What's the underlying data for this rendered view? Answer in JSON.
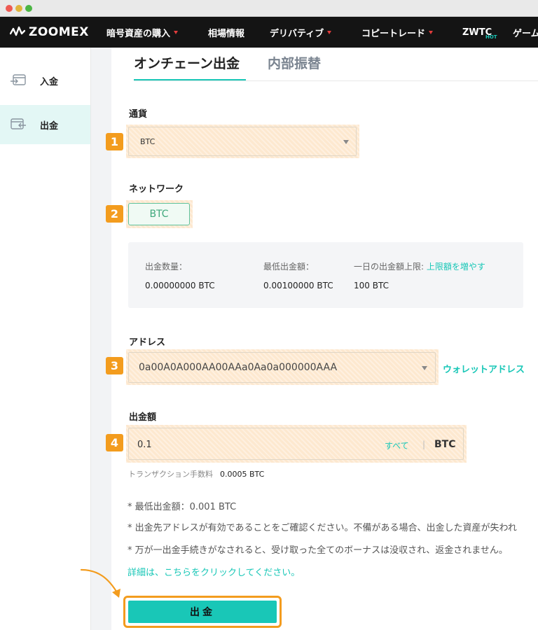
{
  "brand": {
    "name": "ZOOMEX",
    "accent_color": "#19c7b7",
    "highlight_color": "#f39c1e",
    "nav_bg": "#141414"
  },
  "nav": {
    "items": [
      {
        "label": "暗号資産の購入",
        "dropdown": true
      },
      {
        "label": "相場情報",
        "dropdown": false
      },
      {
        "label": "デリバティブ",
        "dropdown": true
      },
      {
        "label": "コピートレード",
        "dropdown": true
      },
      {
        "label": "ZWTC",
        "dropdown": false
      },
      {
        "label": "ゲーム",
        "dropdown": false
      }
    ],
    "hot_badge": "HOT"
  },
  "sidebar": {
    "items": [
      {
        "label": "入金",
        "icon": "deposit-icon",
        "active": false
      },
      {
        "label": "出金",
        "icon": "withdraw-icon",
        "active": true
      }
    ]
  },
  "tabs": {
    "active": "オンチェーン出金",
    "inactive": "内部振替"
  },
  "currency": {
    "label": "通貨",
    "value": "BTC",
    "step": "1"
  },
  "network": {
    "label": "ネットワーク",
    "value": "BTC",
    "step": "2"
  },
  "info": {
    "amount_label": "出金数量：",
    "amount_value": "0.00000000 BTC",
    "min_label": "最低出金額：",
    "min_value": "0.00100000 BTC",
    "daily_limit_label": "一日の出金額上限:",
    "daily_limit_link": "上限額を増やす",
    "daily_limit_value": "100 BTC"
  },
  "address": {
    "label": "アドレス",
    "value": "0a00A0A000AA00AAa0Aa0a000000AAA",
    "wallet_link": "ウォレットアドレス",
    "step": "3"
  },
  "amount": {
    "label": "出金額",
    "value": "0.1",
    "all_label": "すべて",
    "divider": "|",
    "unit": "BTC",
    "step": "4",
    "fee_label": "トランザクション手数料",
    "fee_value": "0.0005 BTC"
  },
  "notes": {
    "line1": "* 最低出金額：0.001 BTC",
    "line2": "* 出金先アドレスが有効であることをご確認ください。不備がある場合、出金した資産が失われ",
    "line3": "* 万が一出金手続きがなされると、受け取った全てのボーナスは没収され、返金されません。",
    "details_link": "詳細は、こちらをクリックしてください。"
  },
  "submit": {
    "label": "出金"
  }
}
